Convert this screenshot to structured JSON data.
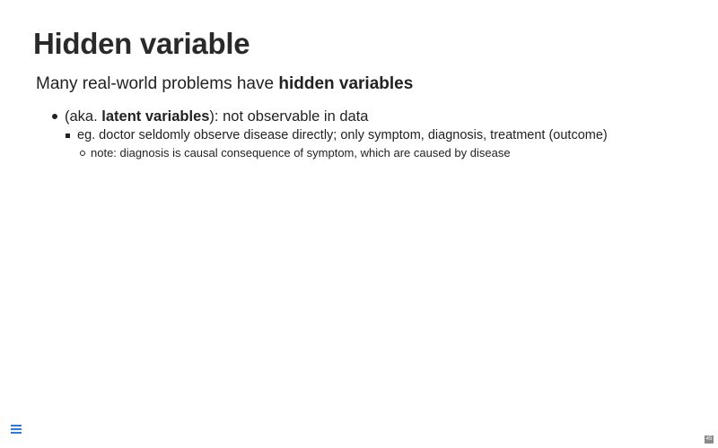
{
  "slide": {
    "title": "Hidden variable",
    "lead": {
      "prefix": "Many real-world problems have ",
      "emphasis": "hidden variables"
    },
    "bullets": [
      {
        "prefix": "(aka. ",
        "emphasis": "latent variables",
        "suffix": "): not observable in data",
        "children": [
          {
            "text": "eg. doctor seldomly observe disease directly; only symptom, diagnosis, treatment (outcome)",
            "children": [
              {
                "text": "note: diagnosis is causal consequence of symptom, which are caused by disease"
              }
            ]
          }
        ]
      }
    ]
  },
  "footer": {
    "menu_icon": "hamburger-menu-icon",
    "page_number": "45",
    "accent_color": "#2a7ae2"
  }
}
